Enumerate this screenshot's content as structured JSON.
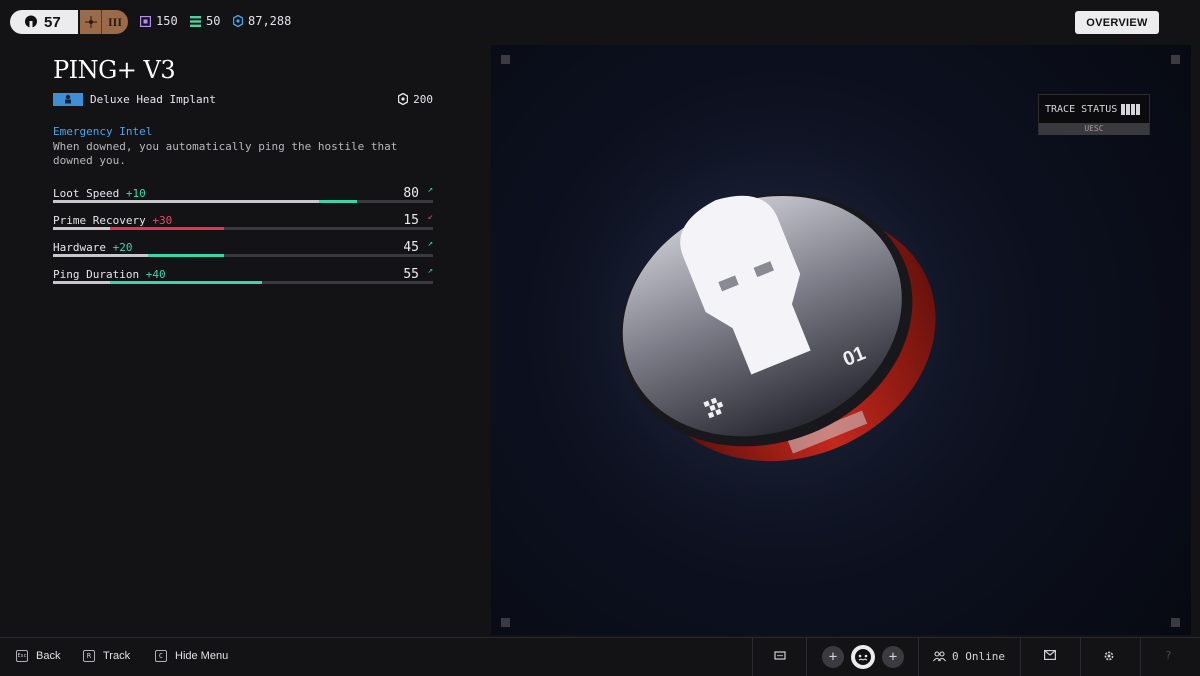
{
  "topbar": {
    "level": "57",
    "rank": "III",
    "currencies": [
      {
        "icon": "purple-chip-icon",
        "value": "150",
        "color": "#b78cf0"
      },
      {
        "icon": "green-stack-icon",
        "value": "50",
        "color": "#4fd39e"
      },
      {
        "icon": "blue-coin-icon",
        "value": "87,288",
        "color": "#4aa3e8"
      }
    ],
    "overview_label": "OVERVIEW"
  },
  "item": {
    "title": "PING+ V3",
    "type": "Deluxe Head Implant",
    "cost": "200",
    "perk_name": "Emergency Intel",
    "perk_desc": "When downed, you automatically ping the hostile that downed you.",
    "stats": [
      {
        "name": "Loot Speed",
        "mod": "+10",
        "value": "80",
        "trend": "up",
        "base": 0.7,
        "bonus": 0.1,
        "color": "#3ad7a6"
      },
      {
        "name": "Prime Recovery",
        "mod": "+30",
        "value": "15",
        "trend": "down",
        "base": 0.15,
        "bonus": 0.3,
        "color": "#e8305a"
      },
      {
        "name": "Hardware",
        "mod": "+20",
        "value": "45",
        "trend": "up",
        "base": 0.25,
        "bonus": 0.2,
        "color": "#3ad7a6"
      },
      {
        "name": "Ping Duration",
        "mod": "+40",
        "value": "55",
        "trend": "up",
        "base": 0.15,
        "bonus": 0.4,
        "color": "#3ad7a6"
      }
    ]
  },
  "preview": {
    "trace_label": "TRACE STATUS",
    "trace_sub": "UESC",
    "device_number": "01"
  },
  "bottombar": {
    "back_key": "Esc",
    "back_label": "Back",
    "track_key": "R",
    "track_label": "Track",
    "hide_key": "C",
    "hide_label": "Hide Menu",
    "online_label": "0 Online"
  }
}
